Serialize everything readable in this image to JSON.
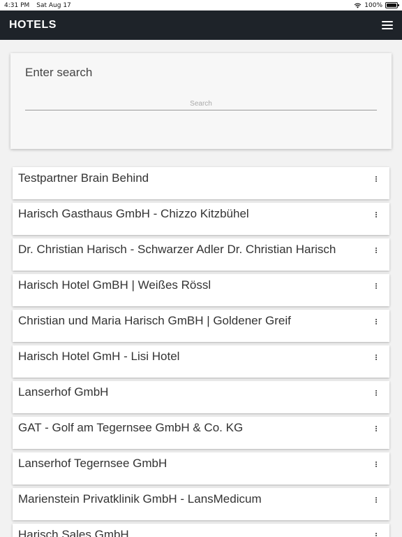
{
  "status_bar": {
    "time": "4:31 PM",
    "date": "Sat Aug 17",
    "battery": "100%"
  },
  "header": {
    "title": "HOTELS",
    "menu_icon": "hamburger-menu-icon"
  },
  "search": {
    "title": "Enter search",
    "placeholder": "Search",
    "value": ""
  },
  "hotels": [
    {
      "name": "Testpartner Brain Behind"
    },
    {
      "name": "Harisch Gasthaus GmbH - Chizzo Kitzbühel"
    },
    {
      "name": "Dr. Christian Harisch - Schwarzer Adler Dr. Christian Harisch"
    },
    {
      "name": "Harisch Hotel GmBH | Weißes Rössl"
    },
    {
      "name": "Christian und Maria Harisch GmBH | Goldener Greif"
    },
    {
      "name": "Harisch Hotel GmH - Lisi Hotel"
    },
    {
      "name": "Lanserhof GmbH"
    },
    {
      "name": "GAT - Golf am Tegernsee GmbH & Co. KG"
    },
    {
      "name": "Lanserhof Tegernsee GmbH"
    },
    {
      "name": "Marienstein Privatklinik GmbH - LansMedicum"
    },
    {
      "name": "Harisch Sales GmbH"
    }
  ],
  "colors": {
    "header_bg": "#1e2329",
    "page_bg": "#f2f2f2",
    "card_bg": "#ffffff"
  }
}
